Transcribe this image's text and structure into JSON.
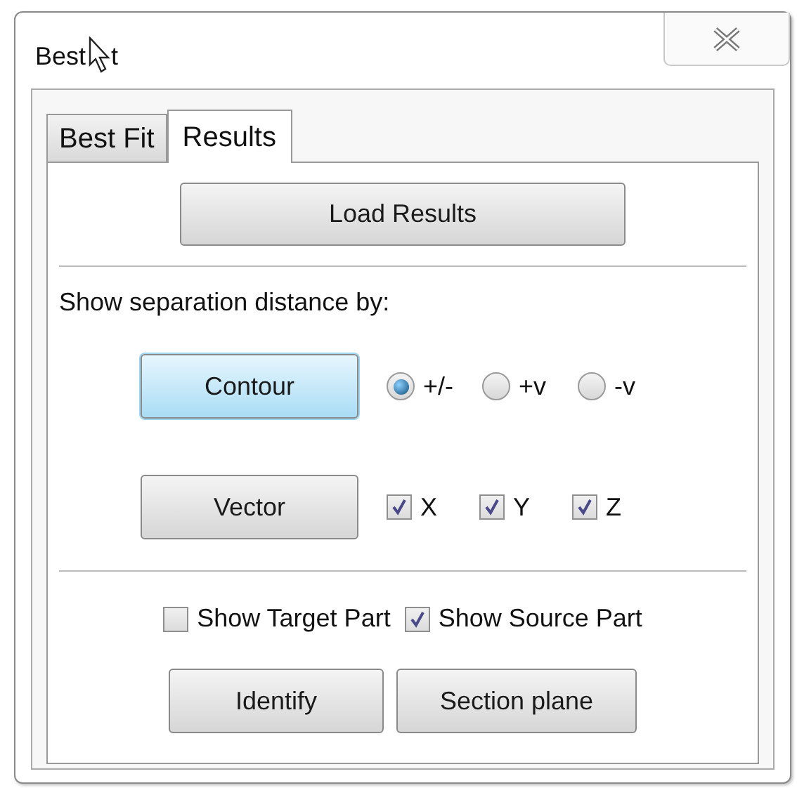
{
  "window": {
    "title_parts": [
      "Best",
      "t"
    ]
  },
  "tabs": [
    {
      "label": "Best Fit",
      "selected": false
    },
    {
      "label": "Results",
      "selected": true
    }
  ],
  "load_button": {
    "label": "Load Results"
  },
  "section_label": "Show separation distance by:",
  "display_rows": [
    {
      "button": {
        "label": "Contour",
        "selected": true
      },
      "kind": "radio",
      "options": [
        {
          "label": "+/-",
          "selected": true
        },
        {
          "label": "+v",
          "selected": false
        },
        {
          "label": "-v",
          "selected": false
        }
      ]
    },
    {
      "button": {
        "label": "Vector",
        "selected": false
      },
      "kind": "checkbox",
      "options": [
        {
          "label": "X",
          "checked": true
        },
        {
          "label": "Y",
          "checked": true
        },
        {
          "label": "Z",
          "checked": true
        }
      ]
    }
  ],
  "part_toggles": [
    {
      "label": "Show Target Part",
      "checked": false
    },
    {
      "label": "Show Source Part",
      "checked": true
    }
  ],
  "action_buttons": [
    {
      "label": "Identify"
    },
    {
      "label": "Section plane"
    }
  ]
}
